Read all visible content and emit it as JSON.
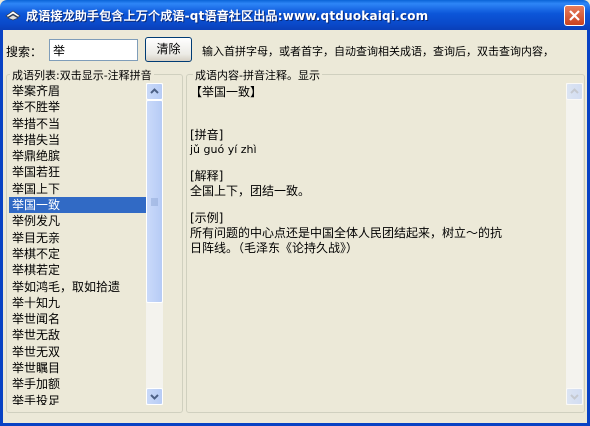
{
  "window": {
    "title": "成语接龙助手包含上万个成语-qt语音社区出品:www.qtduokaiqi.com"
  },
  "icons": {
    "app": "app-icon",
    "close": "close-icon"
  },
  "search": {
    "label": "搜索：",
    "value": "举",
    "clear_label": "清除"
  },
  "hint": "输入首拼字母，或者首字，自动查询相关成语，查询后，双击查询内容，",
  "list_panel": {
    "title": "成语列表:双击显示-注释拼音",
    "items": [
      "举案齐眉",
      "举不胜举",
      "举措不当",
      "举措失当",
      "举鼎绝膑",
      "举国若狂",
      "举国上下",
      "举国一致",
      "举例发凡",
      "举目无亲",
      "举棋不定",
      "举棋若定",
      "举如鸿毛，取如拾遗",
      "举十知九",
      "举世闻名",
      "举世无敌",
      "举世无双",
      "举世瞩目",
      "举手加额",
      "举手投足"
    ],
    "selected_index": 7
  },
  "content_panel": {
    "title": "成语内容-拼音注释。显示",
    "heading": "【举国一致】",
    "pinyin_label": "[拼音]",
    "pinyin": "jǔ  guó  yí  zhì",
    "meaning_label": "[解释]",
    "meaning": "全国上下，团结一致。",
    "example_label": "[示例]",
    "example_line1": "所有问题的中心点还是中国全体人民团结起来，树立～的抗",
    "example_line2": "日阵线。（毛泽东《论持久战》）"
  }
}
